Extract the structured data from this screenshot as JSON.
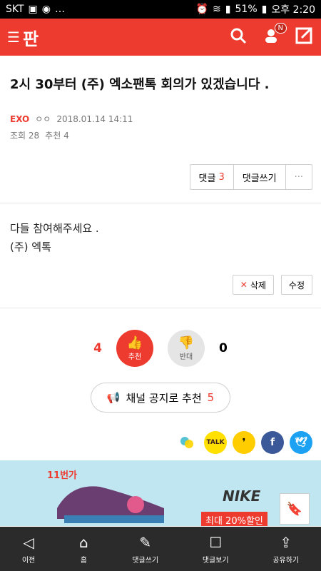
{
  "status": {
    "carrier": "SKT",
    "left_extra": "… ",
    "battery": "51%",
    "time": "오후 2:20"
  },
  "appbar": {
    "logo": "판",
    "badge": "N"
  },
  "post": {
    "title": "2시 30부터 (주) 엑소팬톡 회의가 있겠습니다 .",
    "author": "EXO",
    "nickname": "ㅇㅇ",
    "datetime": "2018.01.14 14:11",
    "views_label": "조회 28",
    "recommend_label": "추천 4",
    "body_lines": [
      "다들 참여해주세요 .",
      "(주) 엑톡"
    ]
  },
  "toolbar": {
    "comments_label": "댓글",
    "comments_count": "3",
    "write_label": "댓글쓰기",
    "more_label": "···"
  },
  "actions": {
    "delete_label": "삭제",
    "edit_label": "수정"
  },
  "vote": {
    "up_count": "4",
    "down_count": "0",
    "up_label": "추천",
    "down_label": "반대"
  },
  "channel": {
    "label": "채널 공지로 추천",
    "count": "5"
  },
  "share": {
    "talk_label": "TALK",
    "facebook_label": "f"
  },
  "ad": {
    "brand1": "11번가",
    "brand2": "NIKE",
    "promo": "최대 20%할인"
  },
  "bottomnav": {
    "items": [
      "이전",
      "홈",
      "댓글쓰기",
      "댓글보기",
      "공유하기"
    ]
  },
  "colors": {
    "accent": "#ee3b2f",
    "nav_bg": "#2b2b2b"
  }
}
